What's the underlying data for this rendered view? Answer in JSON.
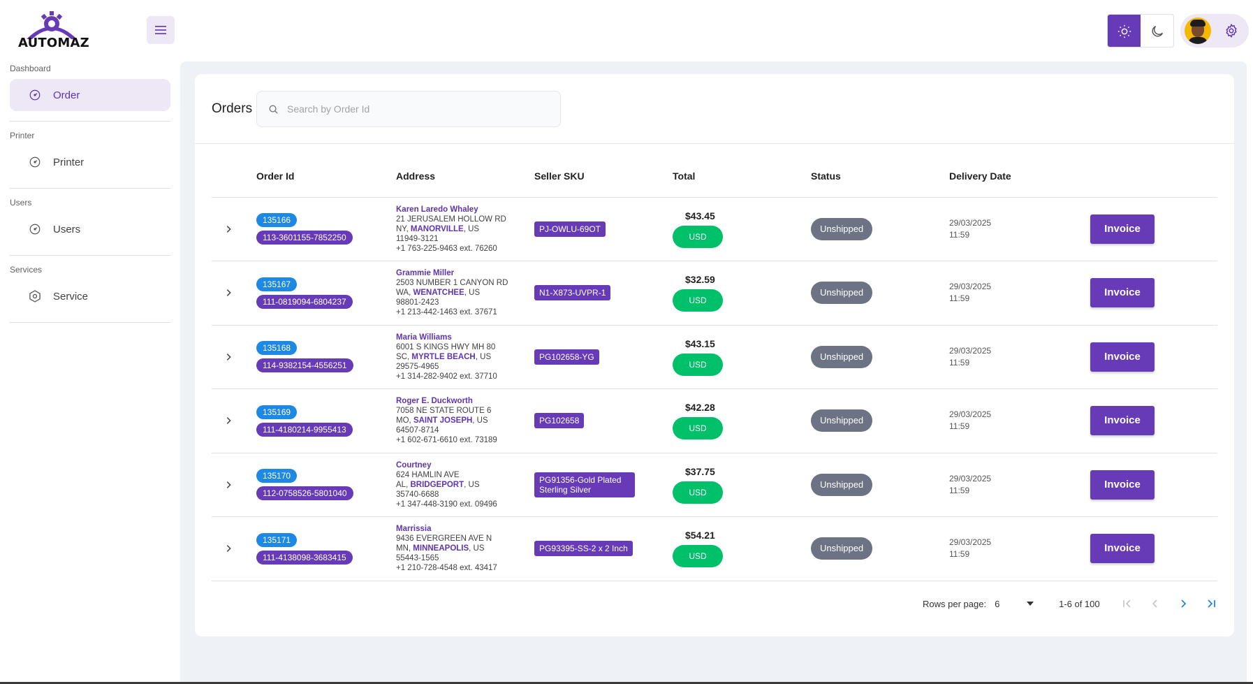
{
  "app": {
    "logo_text": "AUTOMAZ"
  },
  "sidebar": {
    "sections": [
      {
        "label": "Dashboard",
        "item": "Order"
      },
      {
        "label": "Printer",
        "item": "Printer"
      },
      {
        "label": "Users",
        "item": "Users"
      },
      {
        "label": "Services",
        "item": "Service"
      }
    ]
  },
  "orders": {
    "title": "Orders",
    "search_placeholder": "Search by Order Id",
    "columns": [
      "Order Id",
      "Address",
      "Seller SKU",
      "Total",
      "Status",
      "Delivery Date"
    ],
    "rows": [
      {
        "order_id": "135166",
        "amazon_id": "113-3601155-7852250",
        "name": "Karen Laredo Whaley",
        "street": "21 JERUSALEM HOLLOW RD",
        "state": "NY,",
        "city": "MANORVILLE",
        "country": ", US",
        "zip": "11949-3121",
        "phone": "+1 763-225-9463 ext. 76260",
        "sku": "PJ-OWLU-69OT",
        "total": "$43.45",
        "currency": "USD",
        "status": "Unshipped",
        "date": "29/03/2025",
        "time": "11:59",
        "action": "Invoice"
      },
      {
        "order_id": "135167",
        "amazon_id": "111-0819094-6804237",
        "name": "Grammie Miller",
        "street": "2503 NUMBER 1 CANYON RD",
        "state": "WA,",
        "city": "WENATCHEE",
        "country": ", US",
        "zip": "98801-2423",
        "phone": "+1 213-442-1463 ext. 37671",
        "sku": "N1-X873-UVPR-1",
        "total": "$32.59",
        "currency": "USD",
        "status": "Unshipped",
        "date": "29/03/2025",
        "time": "11:59",
        "action": "Invoice"
      },
      {
        "order_id": "135168",
        "amazon_id": "114-9382154-4556251",
        "name": "Maria Williams",
        "street": "6001 S KINGS HWY MH 80",
        "state": "SC,",
        "city": "MYRTLE BEACH",
        "country": ", US",
        "zip": "29575-4965",
        "phone": "+1 314-282-9402 ext. 37710",
        "sku": "PG102658-YG",
        "total": "$43.15",
        "currency": "USD",
        "status": "Unshipped",
        "date": "29/03/2025",
        "time": "11:59",
        "action": "Invoice"
      },
      {
        "order_id": "135169",
        "amazon_id": "111-4180214-9955413",
        "name": "Roger E. Duckworth",
        "street": "7058 NE STATE ROUTE 6",
        "state": "MO,",
        "city": "SAINT JOSEPH",
        "country": ", US",
        "zip": "64507-8714",
        "phone": "+1 602-671-6610 ext. 73189",
        "sku": "PG102658",
        "total": "$42.28",
        "currency": "USD",
        "status": "Unshipped",
        "date": "29/03/2025",
        "time": "11:59",
        "action": "Invoice"
      },
      {
        "order_id": "135170",
        "amazon_id": "112-0758526-5801040",
        "name": "Courtney",
        "street": "624 HAMLIN AVE",
        "state": "AL,",
        "city": "BRIDGEPORT",
        "country": ", US",
        "zip": "35740-6688",
        "phone": "+1 347-448-3190 ext. 09496",
        "sku": "PG91356-Gold Plated Sterling Silver",
        "total": "$37.75",
        "currency": "USD",
        "status": "Unshipped",
        "date": "29/03/2025",
        "time": "11:59",
        "action": "Invoice"
      },
      {
        "order_id": "135171",
        "amazon_id": "111-4138098-3683415",
        "name": "Marrissia",
        "street": "9436 EVERGREEN AVE N",
        "state": "MN,",
        "city": "MINNEAPOLIS",
        "country": ", US",
        "zip": "55443-1565",
        "phone": "+1 210-728-4548 ext. 43417",
        "sku": "PG93395-SS-2 x 2 Inch",
        "total": "$54.21",
        "currency": "USD",
        "status": "Unshipped",
        "date": "29/03/2025",
        "time": "11:59",
        "action": "Invoice"
      }
    ]
  },
  "pagination": {
    "rows_per_page_label": "Rows per page:",
    "rows_per_page": "6",
    "range": "1-6 of 100"
  },
  "colors": {
    "primary": "#673ab7",
    "primary_light": "#ede7f6",
    "blue_chip": "#1e88e5",
    "usd_green": "#00c06a",
    "status_gray": "#6b7384"
  }
}
